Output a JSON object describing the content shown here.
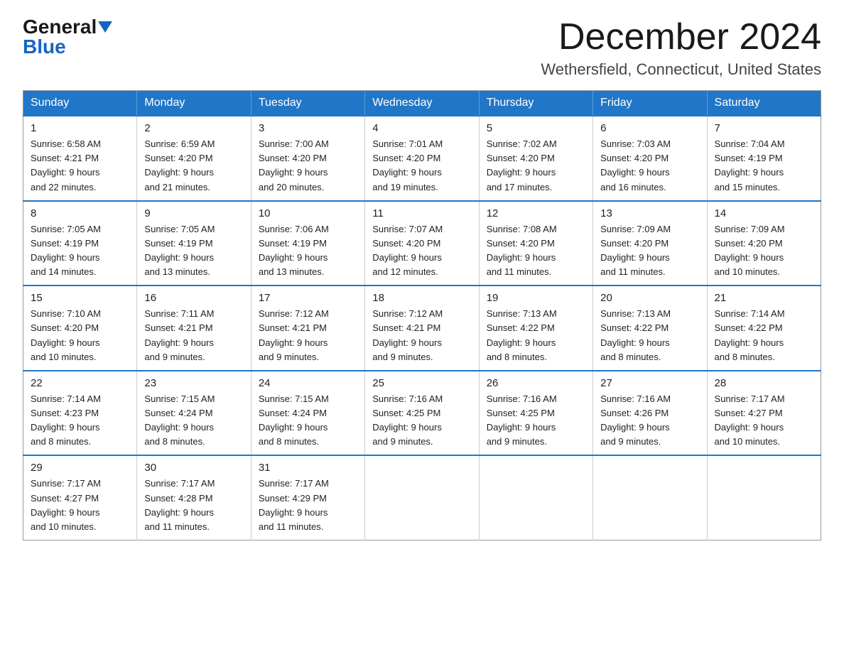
{
  "logo": {
    "general": "General",
    "blue": "Blue"
  },
  "title": "December 2024",
  "subtitle": "Wethersfield, Connecticut, United States",
  "days_of_week": [
    "Sunday",
    "Monday",
    "Tuesday",
    "Wednesday",
    "Thursday",
    "Friday",
    "Saturday"
  ],
  "weeks": [
    [
      {
        "day": "1",
        "sunrise": "6:58 AM",
        "sunset": "4:21 PM",
        "daylight": "9 hours and 22 minutes."
      },
      {
        "day": "2",
        "sunrise": "6:59 AM",
        "sunset": "4:20 PM",
        "daylight": "9 hours and 21 minutes."
      },
      {
        "day": "3",
        "sunrise": "7:00 AM",
        "sunset": "4:20 PM",
        "daylight": "9 hours and 20 minutes."
      },
      {
        "day": "4",
        "sunrise": "7:01 AM",
        "sunset": "4:20 PM",
        "daylight": "9 hours and 19 minutes."
      },
      {
        "day": "5",
        "sunrise": "7:02 AM",
        "sunset": "4:20 PM",
        "daylight": "9 hours and 17 minutes."
      },
      {
        "day": "6",
        "sunrise": "7:03 AM",
        "sunset": "4:20 PM",
        "daylight": "9 hours and 16 minutes."
      },
      {
        "day": "7",
        "sunrise": "7:04 AM",
        "sunset": "4:19 PM",
        "daylight": "9 hours and 15 minutes."
      }
    ],
    [
      {
        "day": "8",
        "sunrise": "7:05 AM",
        "sunset": "4:19 PM",
        "daylight": "9 hours and 14 minutes."
      },
      {
        "day": "9",
        "sunrise": "7:05 AM",
        "sunset": "4:19 PM",
        "daylight": "9 hours and 13 minutes."
      },
      {
        "day": "10",
        "sunrise": "7:06 AM",
        "sunset": "4:19 PM",
        "daylight": "9 hours and 13 minutes."
      },
      {
        "day": "11",
        "sunrise": "7:07 AM",
        "sunset": "4:20 PM",
        "daylight": "9 hours and 12 minutes."
      },
      {
        "day": "12",
        "sunrise": "7:08 AM",
        "sunset": "4:20 PM",
        "daylight": "9 hours and 11 minutes."
      },
      {
        "day": "13",
        "sunrise": "7:09 AM",
        "sunset": "4:20 PM",
        "daylight": "9 hours and 11 minutes."
      },
      {
        "day": "14",
        "sunrise": "7:09 AM",
        "sunset": "4:20 PM",
        "daylight": "9 hours and 10 minutes."
      }
    ],
    [
      {
        "day": "15",
        "sunrise": "7:10 AM",
        "sunset": "4:20 PM",
        "daylight": "9 hours and 10 minutes."
      },
      {
        "day": "16",
        "sunrise": "7:11 AM",
        "sunset": "4:21 PM",
        "daylight": "9 hours and 9 minutes."
      },
      {
        "day": "17",
        "sunrise": "7:12 AM",
        "sunset": "4:21 PM",
        "daylight": "9 hours and 9 minutes."
      },
      {
        "day": "18",
        "sunrise": "7:12 AM",
        "sunset": "4:21 PM",
        "daylight": "9 hours and 9 minutes."
      },
      {
        "day": "19",
        "sunrise": "7:13 AM",
        "sunset": "4:22 PM",
        "daylight": "9 hours and 8 minutes."
      },
      {
        "day": "20",
        "sunrise": "7:13 AM",
        "sunset": "4:22 PM",
        "daylight": "9 hours and 8 minutes."
      },
      {
        "day": "21",
        "sunrise": "7:14 AM",
        "sunset": "4:22 PM",
        "daylight": "9 hours and 8 minutes."
      }
    ],
    [
      {
        "day": "22",
        "sunrise": "7:14 AM",
        "sunset": "4:23 PM",
        "daylight": "9 hours and 8 minutes."
      },
      {
        "day": "23",
        "sunrise": "7:15 AM",
        "sunset": "4:24 PM",
        "daylight": "9 hours and 8 minutes."
      },
      {
        "day": "24",
        "sunrise": "7:15 AM",
        "sunset": "4:24 PM",
        "daylight": "9 hours and 8 minutes."
      },
      {
        "day": "25",
        "sunrise": "7:16 AM",
        "sunset": "4:25 PM",
        "daylight": "9 hours and 9 minutes."
      },
      {
        "day": "26",
        "sunrise": "7:16 AM",
        "sunset": "4:25 PM",
        "daylight": "9 hours and 9 minutes."
      },
      {
        "day": "27",
        "sunrise": "7:16 AM",
        "sunset": "4:26 PM",
        "daylight": "9 hours and 9 minutes."
      },
      {
        "day": "28",
        "sunrise": "7:17 AM",
        "sunset": "4:27 PM",
        "daylight": "9 hours and 10 minutes."
      }
    ],
    [
      {
        "day": "29",
        "sunrise": "7:17 AM",
        "sunset": "4:27 PM",
        "daylight": "9 hours and 10 minutes."
      },
      {
        "day": "30",
        "sunrise": "7:17 AM",
        "sunset": "4:28 PM",
        "daylight": "9 hours and 11 minutes."
      },
      {
        "day": "31",
        "sunrise": "7:17 AM",
        "sunset": "4:29 PM",
        "daylight": "9 hours and 11 minutes."
      },
      null,
      null,
      null,
      null
    ]
  ]
}
